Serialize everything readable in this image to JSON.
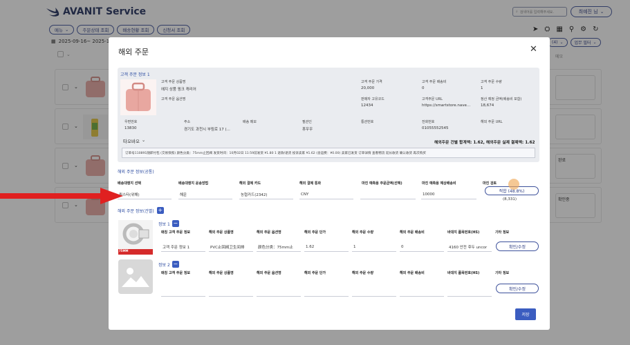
{
  "app": {
    "title": "AVANIT Service",
    "search_placeholder": "검색어를 입력해주세요.",
    "user": "최예진 님"
  },
  "menus": [
    "메뉴",
    "주문상태 조회",
    "배송현황 조회",
    "신청서 조회"
  ],
  "date_range": "2025-09-16~ 2025-1",
  "right_selects": [
    "(4)",
    "업무 필터"
  ],
  "memo_header": "메모",
  "bg_rows": [
    {
      "memo": ""
    },
    {
      "memo": ""
    },
    {
      "memo": "완료"
    },
    {
      "memo": "확인중"
    }
  ],
  "modal": {
    "title": "해외 주문",
    "customer_section": {
      "title": "고객 주문 정보 1",
      "product_name_label": "고객 주문 상품명",
      "product_name": "에지 상품 핑크 캐리어",
      "option_label": "고객 주문 옵션명",
      "option": "",
      "price_label": "고객 주문 가격",
      "price": "20,000",
      "ship_fee_label": "고객 주문 배송비",
      "ship_fee": "0",
      "qty_label": "고객 주문 수량",
      "qty": "1",
      "seller_code_label": "판매자 고유코드",
      "seller_code": "12434",
      "url_label": "고객주문 URL",
      "url": "https://smartstore.nave...",
      "settle_label": "정산 예정 금액(배송비 포함)",
      "settle": "18,674",
      "zip_label": "우편번호",
      "zip": "13830",
      "addr_label": "주소",
      "addr": "경기도 과천시 부림로 17 (...",
      "memo_label": "배송 메모",
      "memo": "",
      "receiver_label": "필관인",
      "receiver": "휴우우",
      "customs_label": "통관번호",
      "customs": "",
      "phone_label": "전화번호",
      "phone": "01055552545",
      "overseas_url_label": "해외 주문 URL",
      "overseas_url": "",
      "store": "타오바오",
      "totals": "해외주문 건별 합계액: 1.62, 해외주문 실제 결제액: 1.62",
      "raw_text": "订单号110891随即付包 (交易快照) 颜色分类：75mm止回阀 发货时间：10月02日 11:59前发货   ¥1.80   1   退款/退货 投诉卖家   ¥1.62 (含运费：¥0.00)   卖家已发货 订单详情 查看物流   延长收货 确认收货 再次购买"
    },
    "payment_section": {
      "title": "해외 주문 정보(공통)",
      "agent_label": "배송대행지 선택",
      "agent": "퀵스타(위해)",
      "method_label": "배송대행지 운송방법",
      "method": "해운",
      "card_label": "해외 결제 카드",
      "card": "농협카드(2342)",
      "currency_label": "해외 결제 통화",
      "currency": "CNY",
      "expected_label": "마진 예측용 주문금액(선택)",
      "expected": "",
      "expected_ship_label": "마진 예측용 예상배송비",
      "expected_ship": "10000",
      "margin_label": "마진 검토",
      "margin_btn": "적합 (48.8%)",
      "margin_sub": "(8,331)"
    },
    "item_section": {
      "title": "해외 주문 정보(건별)",
      "headers": [
        "매칭 고객 주문 정보",
        "해외 주문 상품명",
        "해외 주문 옵션명",
        "해외 주문 단가",
        "해외 주문 수량",
        "해외 주문 배송비",
        "바대지 품목번호(HS)",
        "기타 정보"
      ],
      "items": [
        {
          "label": "정보 1",
          "values": [
            "고객 주문 정보 1",
            "PVC止回阀卫生间排",
            "颜色分类：75mm止",
            "1.62",
            "1",
            "0",
            "4160 안전 후두 uncor"
          ],
          "btn": "확인/수정",
          "badge": "75MM"
        },
        {
          "label": "정보 2",
          "values": [
            "",
            "",
            "",
            "",
            "",
            "",
            ""
          ],
          "btn": "확인/수정",
          "badge": ""
        }
      ]
    },
    "save": "저장"
  }
}
